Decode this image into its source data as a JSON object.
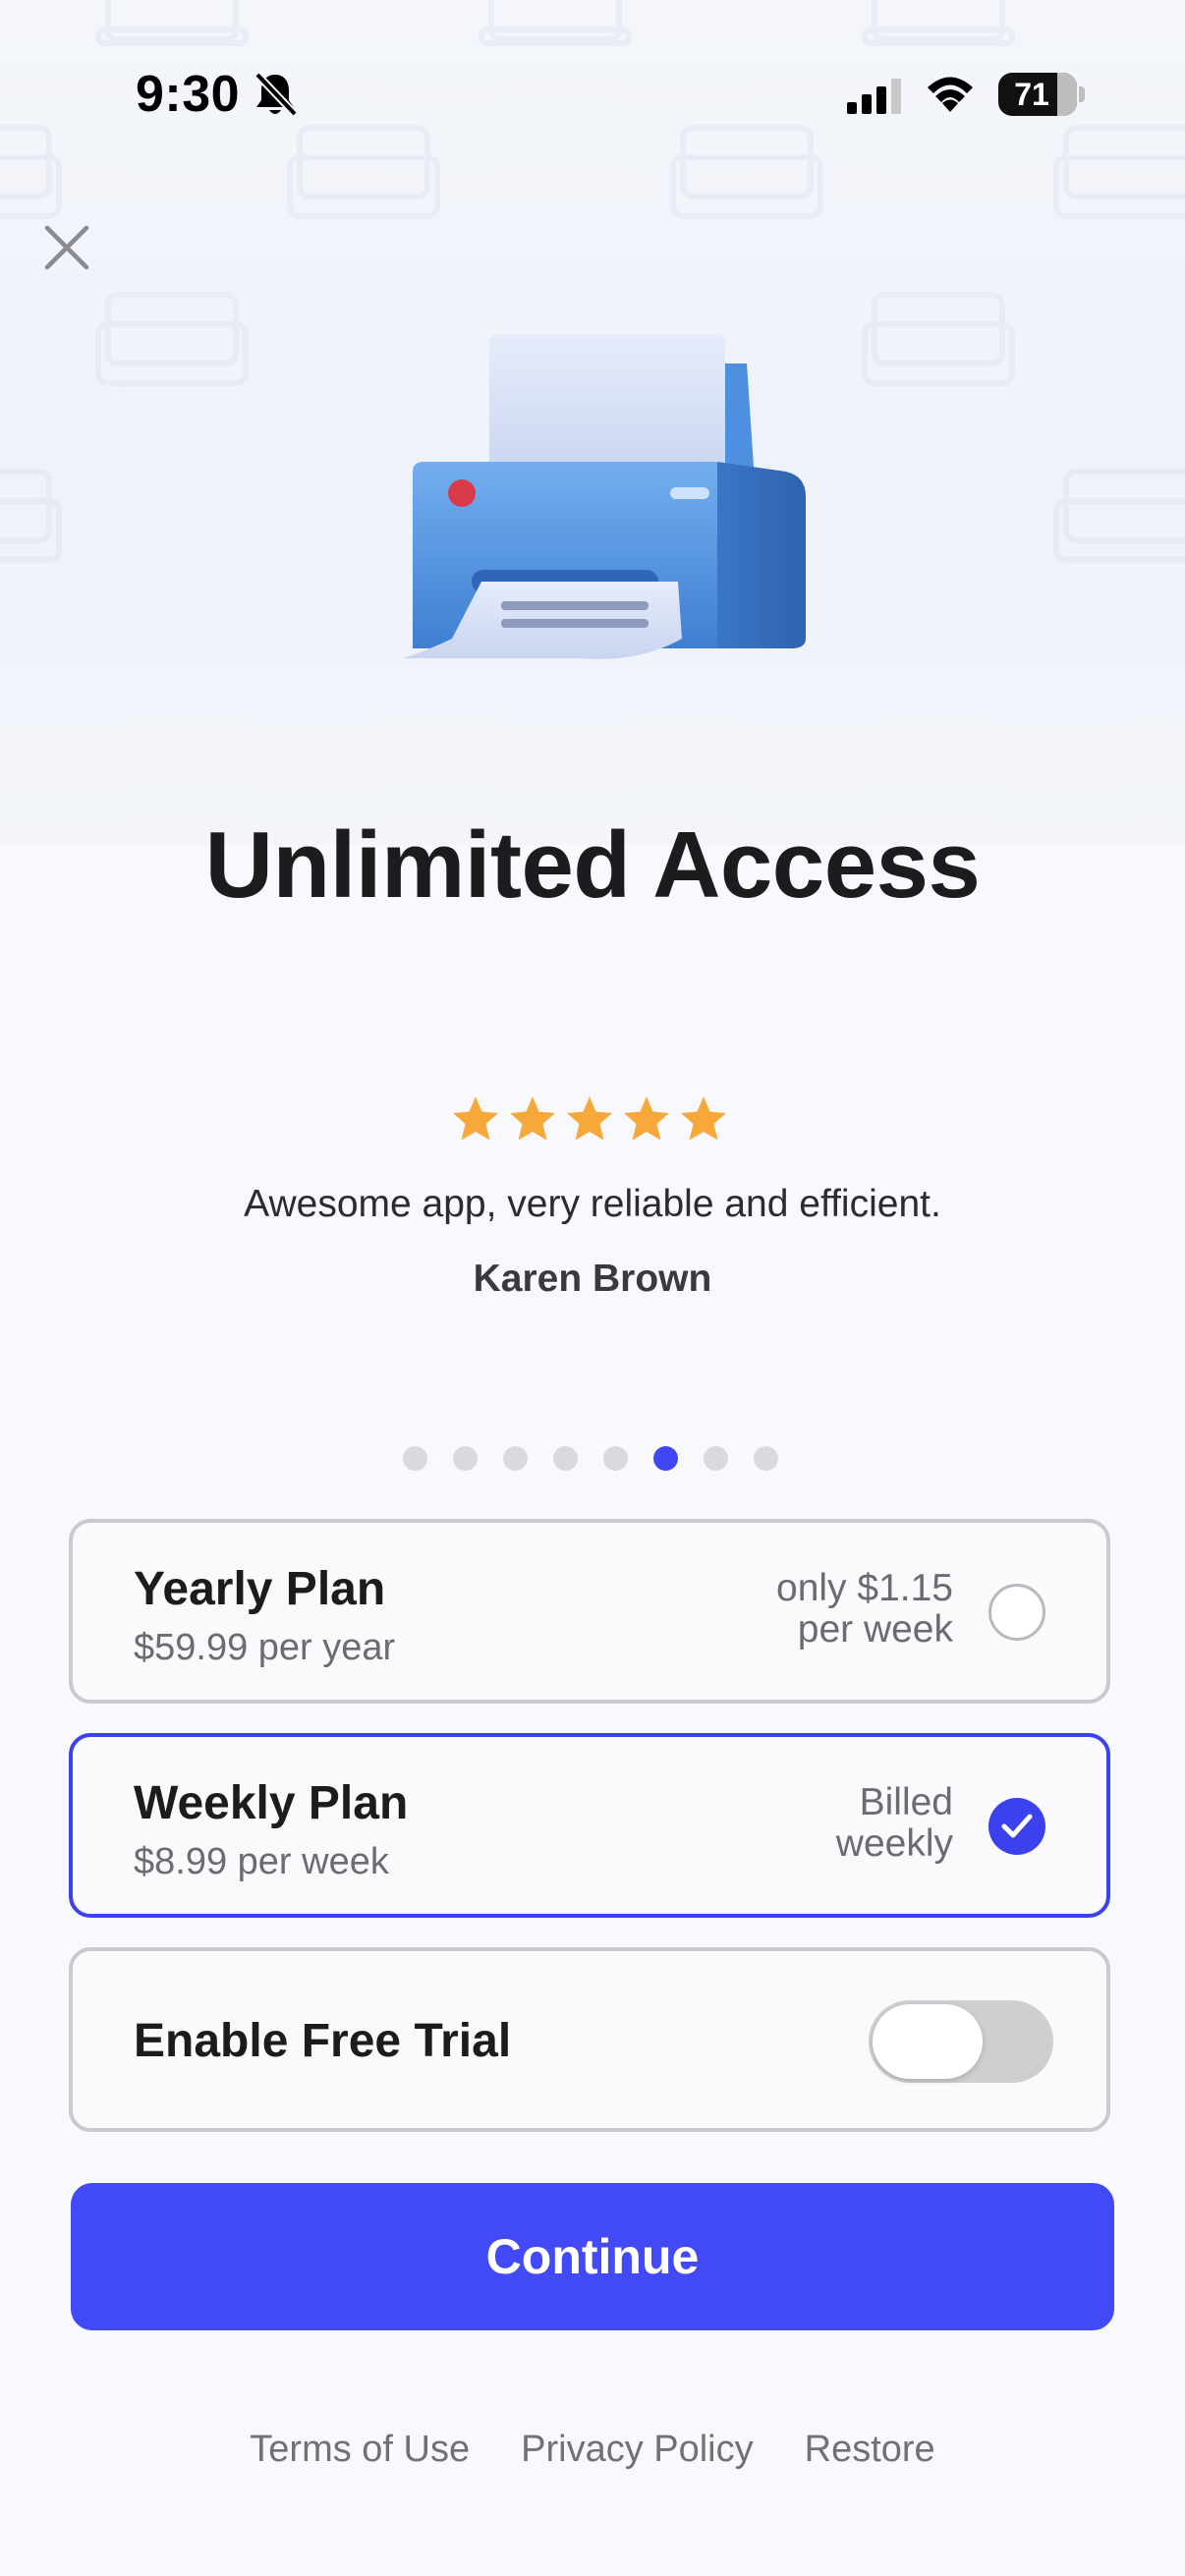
{
  "status_bar": {
    "time": "9:30",
    "battery": "71",
    "icons": [
      "bell-slash-icon",
      "cellular-signal-icon",
      "wifi-icon",
      "battery-icon"
    ]
  },
  "header": {
    "close_icon": "close-icon"
  },
  "hero": {
    "image": "printer-illustration"
  },
  "title": "Unlimited Access",
  "testimonial": {
    "rating": 5,
    "rating_max": 5,
    "review": "Awesome app, very reliable and efficient.",
    "reviewer": "Karen Brown"
  },
  "pager": {
    "count": 8,
    "active_index": 5
  },
  "plans": [
    {
      "name": "Yearly Plan",
      "price": "$59.99 per year",
      "note_line1": "only $1.15",
      "note_line2": "per week",
      "selected": false
    },
    {
      "name": "Weekly Plan",
      "price": "$8.99 per week",
      "note_line1": "Billed",
      "note_line2": "weekly",
      "selected": true
    }
  ],
  "free_trial": {
    "label": "Enable Free Trial",
    "enabled": false
  },
  "cta": {
    "label": "Continue"
  },
  "footer": {
    "terms": "Terms of Use",
    "privacy": "Privacy Policy",
    "restore": "Restore"
  },
  "colors": {
    "accent": "#4249f7",
    "star": "#f7a83b",
    "selected_border": "#3c41ee"
  }
}
